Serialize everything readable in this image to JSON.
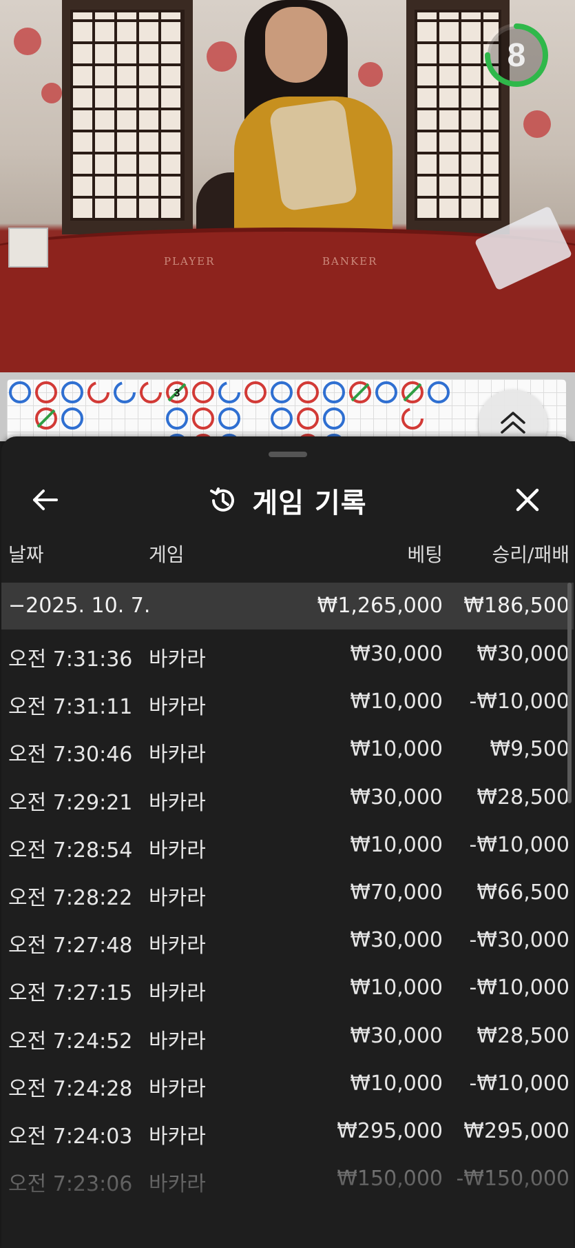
{
  "video": {
    "felt_label_player": "PLAYER",
    "felt_label_banker": "BANKER",
    "timer_value": "8",
    "timer_progress": 0.75
  },
  "roadmap": {
    "row1": [
      "P",
      "B",
      "P",
      "B-",
      "P-",
      "B-",
      "T3",
      "B",
      "P-",
      "B",
      "P",
      "B",
      "P",
      "T",
      "P",
      "T",
      "P"
    ],
    "row2": [
      "",
      "T",
      "P",
      "",
      "",
      "",
      "P",
      "B",
      "P",
      "",
      "P",
      "B",
      "P",
      "",
      "",
      "B-",
      ""
    ]
  },
  "sheet": {
    "title": "게임 기록",
    "icons": {
      "back": "arrow-left-icon",
      "history": "history-icon",
      "close": "close-icon",
      "expand": "chevron-up-double-icon"
    },
    "columns": {
      "date": "날짜",
      "game": "게임",
      "bet": "베팅",
      "win_loss": "승리/패배"
    },
    "date_group": {
      "label": "−2025. 10. 7.",
      "bet_total": "₩1,265,000",
      "win_loss_total": "₩186,500"
    },
    "rows": [
      {
        "time": "오전 7:31:36",
        "game": "바카라",
        "bet": "₩30,000",
        "result": "₩30,000"
      },
      {
        "time": "오전 7:31:11",
        "game": "바카라",
        "bet": "₩10,000",
        "result": "-₩10,000"
      },
      {
        "time": "오전 7:30:46",
        "game": "바카라",
        "bet": "₩10,000",
        "result": "₩9,500"
      },
      {
        "time": "오전 7:29:21",
        "game": "바카라",
        "bet": "₩30,000",
        "result": "₩28,500"
      },
      {
        "time": "오전 7:28:54",
        "game": "바카라",
        "bet": "₩10,000",
        "result": "-₩10,000"
      },
      {
        "time": "오전 7:28:22",
        "game": "바카라",
        "bet": "₩70,000",
        "result": "₩66,500"
      },
      {
        "time": "오전 7:27:48",
        "game": "바카라",
        "bet": "₩30,000",
        "result": "-₩30,000"
      },
      {
        "time": "오전 7:27:15",
        "game": "바카라",
        "bet": "₩10,000",
        "result": "-₩10,000"
      },
      {
        "time": "오전 7:24:52",
        "game": "바카라",
        "bet": "₩30,000",
        "result": "₩28,500"
      },
      {
        "time": "오전 7:24:28",
        "game": "바카라",
        "bet": "₩10,000",
        "result": "-₩10,000"
      },
      {
        "time": "오전 7:24:03",
        "game": "바카라",
        "bet": "₩295,000",
        "result": "₩295,000"
      },
      {
        "time": "오전 7:23:06",
        "game": "바카라",
        "bet": "₩150,000",
        "result": "-₩150,000"
      }
    ]
  },
  "colors": {
    "player_blue": "#2f6fd1",
    "banker_red": "#d23a36",
    "tie_green": "#2f9e44",
    "sheet_bg": "#1e1e1e",
    "group_row_bg": "#3a3a3a"
  }
}
